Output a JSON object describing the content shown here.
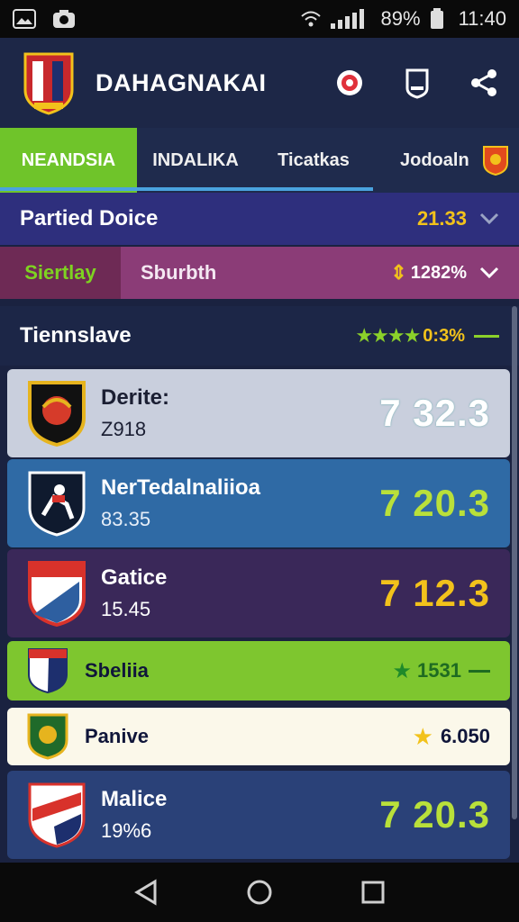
{
  "status_bar": {
    "battery": "89%",
    "time": "11:40"
  },
  "header": {
    "title": "DAHAGNAKAI"
  },
  "tabs": [
    {
      "label": "NEANDSIA",
      "active": true
    },
    {
      "label": "INDALIKA",
      "active": false
    },
    {
      "label": "Ticatkas",
      "active": false
    },
    {
      "label": "Jodoaln",
      "active": false
    }
  ],
  "row_a": {
    "label": "Partied Doice",
    "value": "21.33"
  },
  "row_b": {
    "tag": "Siertlay",
    "label": "Sburbth",
    "value": "1282%"
  },
  "section": {
    "title": "Tiennslave",
    "rating_value": "0:3%"
  },
  "cards": [
    {
      "name": "Derite:",
      "sub": "Z918",
      "score": "7 32.3"
    },
    {
      "name": "NerTedalnaliioa",
      "sub": "83.35",
      "score": "7 20.3"
    },
    {
      "name": "Gatice",
      "sub": "15.45",
      "score": "7 12.3"
    },
    {
      "name": "Sbeliia",
      "sub": "",
      "score": "1531"
    },
    {
      "name": "Panive",
      "sub": "",
      "score": "6.050"
    },
    {
      "name": "Malice",
      "sub": "19%6",
      "score": "7 20.3"
    }
  ],
  "colors": {
    "tab_active": "#6fc42a",
    "row_a": "#2e2f7d",
    "row_b": "#8b3c77",
    "accent_yellow": "#f2c21b",
    "accent_green": "#8bd12a"
  }
}
